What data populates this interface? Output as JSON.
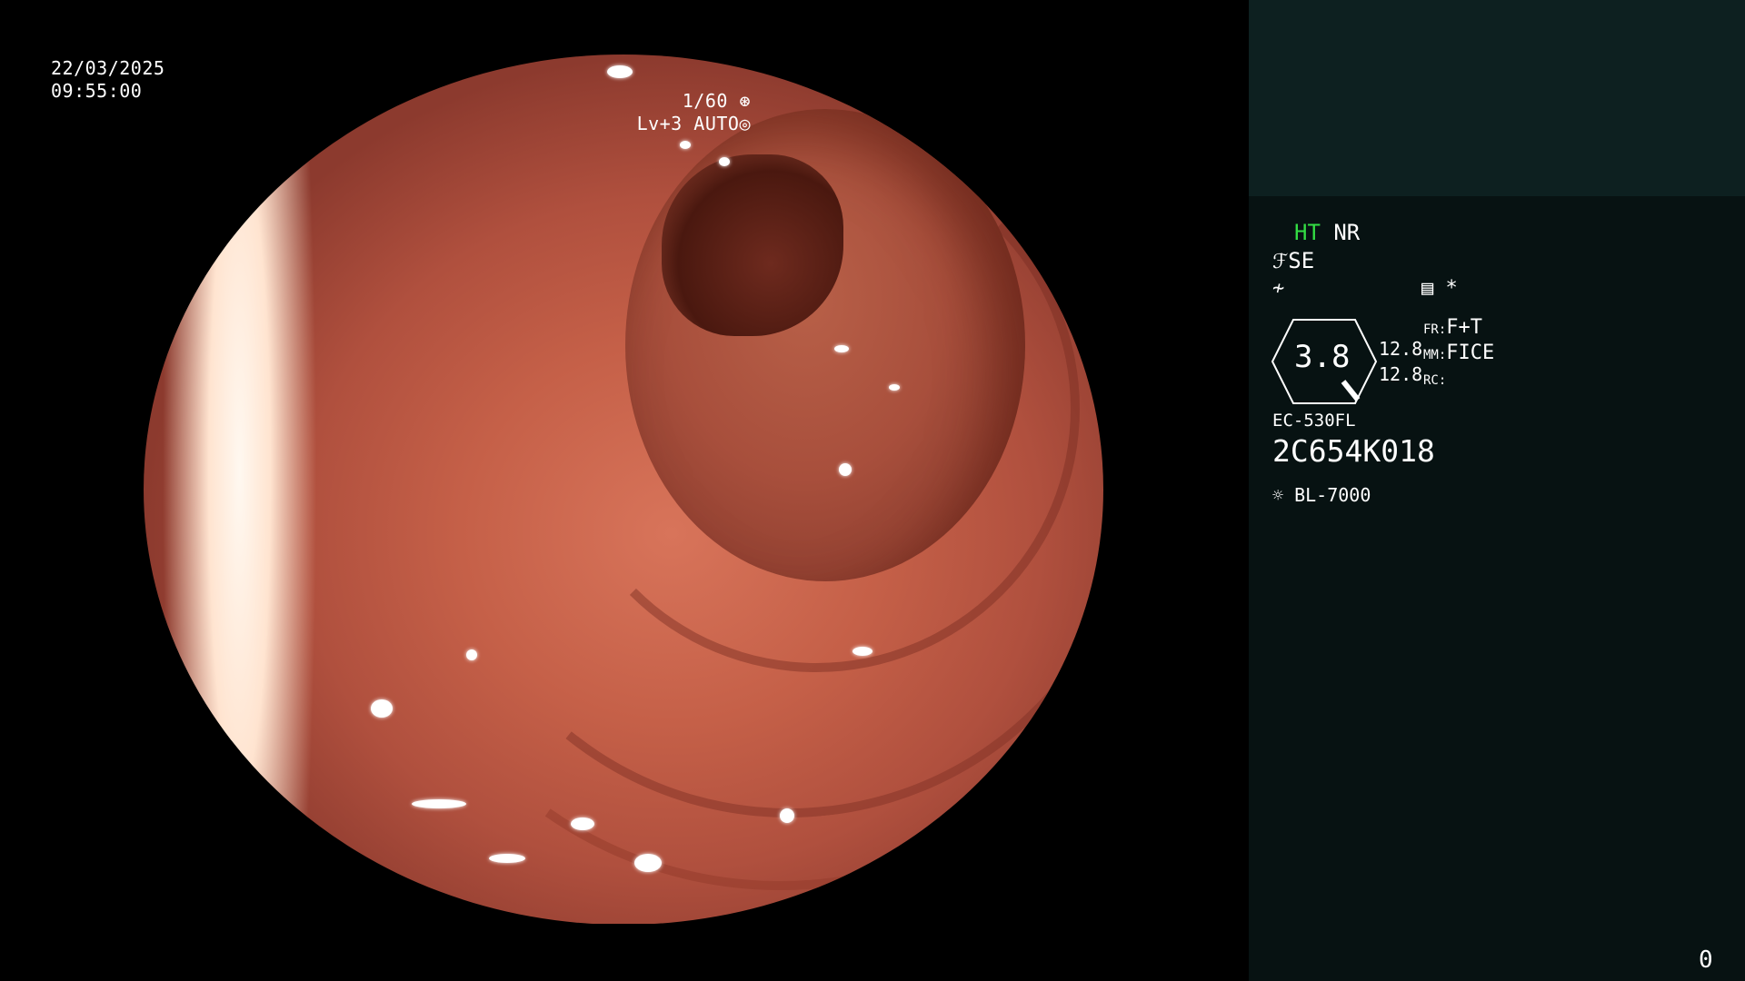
{
  "overlay": {
    "date": "22/03/2025",
    "time": "09:55:00",
    "shutter": "1/60",
    "level": "Lv+3",
    "mode": "AUTO"
  },
  "panel": {
    "ht": "HT",
    "nr": "NR",
    "se": "SE",
    "asterisk": "*",
    "gain": "3.8",
    "value_top": "12.8",
    "value_bottom": "12.8",
    "fr_label": "FR:",
    "fr_value": "F+T",
    "mm_label": "MM:",
    "mm_value": "FICE",
    "rc_label": "RC:",
    "model": "EC-530FL",
    "serial": "2C654K018",
    "light_source": "BL-7000",
    "frame_count": "0"
  },
  "icons": {
    "shutter": "aperture-icon",
    "auto": "iris-icon",
    "se": "structure-enhance-icon",
    "color": "color-enhance-icon",
    "record": "record-settings-icon",
    "light": "lamp-icon"
  },
  "colors": {
    "ht_active": "#33dd44",
    "sidebar_bg": "#071212",
    "sidebar_top": "#0d2020"
  }
}
